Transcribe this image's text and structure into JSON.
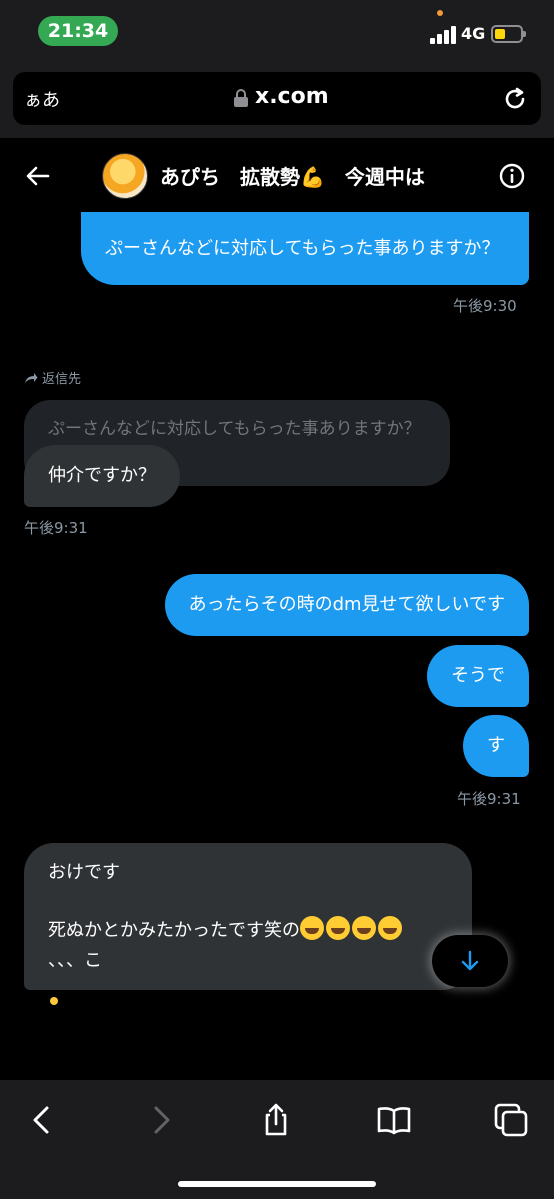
{
  "status_bar": {
    "time": "21:34",
    "network": "4G"
  },
  "browser": {
    "text_size_label": "ぁあ",
    "domain": "x.com"
  },
  "chat": {
    "title": "あぴち　拡散勢💪　今週中は"
  },
  "messages": {
    "m1": {
      "text": "ぷーさんなどに対応してもらった事ありますか？",
      "time": "午後9:30"
    },
    "reply": {
      "label": "返信先",
      "quoted": "ぷーさんなどに対応してもらった事ありますか？",
      "text": "仲介ですか？",
      "time": "午後9:31"
    },
    "m3": {
      "text": "あったらその時のdm見せて欲しいです"
    },
    "m4": {
      "text": "そうで"
    },
    "m5": {
      "text": "す",
      "time": "午後9:31"
    },
    "m6": {
      "line1": "おけです",
      "line2": "死ぬかとかみたかったです笑の",
      "line3": "、、、こ"
    }
  },
  "colors": {
    "sent_bubble": "#1d9bf0",
    "received_bubble": "#2f3336",
    "background": "#000000"
  },
  "icons": [
    "back-arrow-icon",
    "info-icon",
    "lock-icon",
    "reload-icon",
    "reply-arrow-icon",
    "scroll-down-icon",
    "browser-back-icon",
    "browser-forward-icon",
    "share-icon",
    "bookmarks-icon",
    "tabs-icon"
  ]
}
